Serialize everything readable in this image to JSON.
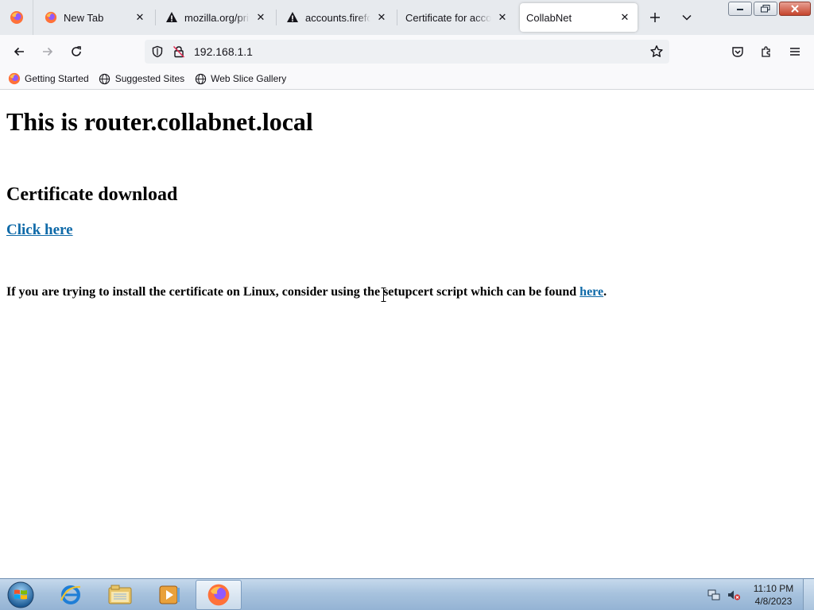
{
  "browser": {
    "tabs": [
      {
        "label": "New Tab",
        "icon": "firefox-icon",
        "active": false
      },
      {
        "label": "mozilla.org/privac",
        "icon": "warning-icon",
        "active": false
      },
      {
        "label": "accounts.firefox.c",
        "icon": "warning-icon",
        "active": false
      },
      {
        "label": "Certificate for accoun",
        "icon": "",
        "active": false
      },
      {
        "label": "CollabNet",
        "icon": "",
        "active": true
      }
    ],
    "url": "192.168.1.1",
    "bookmarks": [
      {
        "label": "Getting Started",
        "icon": "firefox-icon"
      },
      {
        "label": "Suggested Sites",
        "icon": "globe-icon"
      },
      {
        "label": "Web Slice Gallery",
        "icon": "globe-icon"
      }
    ]
  },
  "page": {
    "heading": "This is router.collabnet.local",
    "subheading": "Certificate download",
    "download_link": "Click here",
    "linux_note_before": "If you are trying to install the certificate on Linux, consider using the setupcert script which can be found ",
    "linux_note_link": "here",
    "linux_note_after": "."
  },
  "taskbar": {
    "time": "11:10 PM",
    "date": "4/8/2023"
  },
  "colors": {
    "link": "#0f6aa8",
    "tabstrip": "#e7eaee",
    "taskbar": "#a8c3de"
  }
}
